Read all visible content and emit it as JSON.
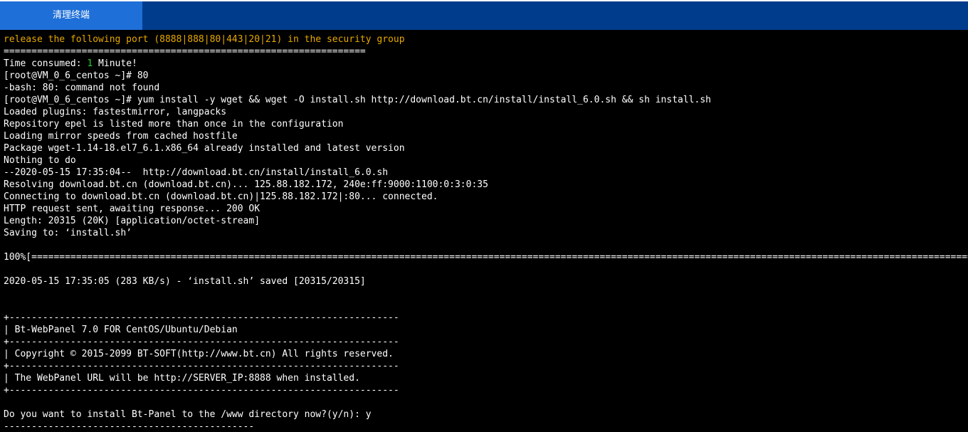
{
  "toolbar": {
    "clear_button_label": "清理终端"
  },
  "colors": {
    "toolbar_bg": "#003c8c",
    "button_bg": "#1e6fd8",
    "terminal_bg": "#000000",
    "text": "#ffffff",
    "warning_text": "#e6a800",
    "highlight_number": "#2bd02b"
  },
  "terminal": {
    "lines": [
      "release the following port (8888|888|80|443|20|21) in the security group",
      "=================================================================",
      "Time consumed: ",
      "[root@VM_0_6_centos ~]# 80",
      "-bash: 80: command not found",
      "[root@VM_0_6_centos ~]# yum install -y wget && wget -O install.sh http://download.bt.cn/install/install_6.0.sh && sh install.sh",
      "Loaded plugins: fastestmirror, langpacks",
      "Repository epel is listed more than once in the configuration",
      "Loading mirror speeds from cached hostfile",
      "Package wget-1.14-18.el7_6.1.x86_64 already installed and latest version",
      "Nothing to do",
      "--2020-05-15 17:35:04--  http://download.bt.cn/install/install_6.0.sh",
      "Resolving download.bt.cn (download.bt.cn)... 125.88.182.172, 240e:ff:9000:1100:0:3:0:35",
      "Connecting to download.bt.cn (download.bt.cn)|125.88.182.172|:80... connected.",
      "HTTP request sent, awaiting response... 200 OK",
      "Length: 20315 (20K) [application/octet-stream]",
      "Saving to: ‘install.sh’",
      "",
      "100%[==========================================================================================================================================================================",
      "",
      "2020-05-15 17:35:05 (283 KB/s) - ‘install.sh’ saved [20315/20315]",
      "",
      "",
      "+----------------------------------------------------------------------",
      "| Bt-WebPanel 7.0 FOR CentOS/Ubuntu/Debian",
      "+----------------------------------------------------------------------",
      "| Copyright © 2015-2099 BT-SOFT(http://www.bt.cn) All rights reserved.",
      "+----------------------------------------------------------------------",
      "| The WebPanel URL will be http://SERVER_IP:8888 when installed.",
      "+----------------------------------------------------------------------",
      "",
      "Do you want to install Bt-Panel to the /www directory now?(y/n): y",
      "---------------------------------------------"
    ],
    "time_consumed_value": "1",
    "time_consumed_suffix": " Minute!"
  }
}
